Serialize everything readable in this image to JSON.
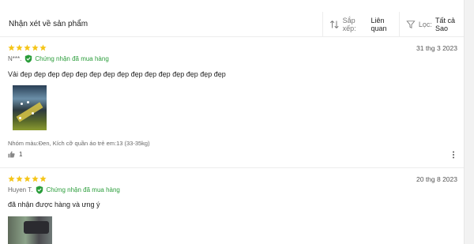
{
  "header": {
    "title": "Nhận xét về sản phẩm",
    "sort_label": "Sắp xếp:",
    "sort_value": "Liên quan",
    "sort_icon": "sort-arrows-icon",
    "filter_label": "Lọc:",
    "filter_value": "Tất cả Sao",
    "filter_icon": "funnel-icon"
  },
  "colors": {
    "star": "#f5c518",
    "verified": "#2a9d3a"
  },
  "reviews": [
    {
      "rating": 5,
      "date": "31 thg 3 2023",
      "user": "N***.",
      "verified_text": "Chứng nhận đã mua hàng",
      "comment": "Vải đẹp đẹp đẹp đẹp đẹp đẹp đẹp đẹp đẹp đẹp đẹp đẹp đẹp đẹp đẹp",
      "variant": "Nhóm màu:Đen, Kích cỡ quần áo trẻ em:13 (33-35kg)",
      "likes": "1"
    },
    {
      "rating": 5,
      "date": "20 thg 8 2023",
      "user": "Huyen T.",
      "verified_text": "Chứng nhận đã mua hàng",
      "comment": "đã nhận được hàng và ưng ý"
    }
  ]
}
